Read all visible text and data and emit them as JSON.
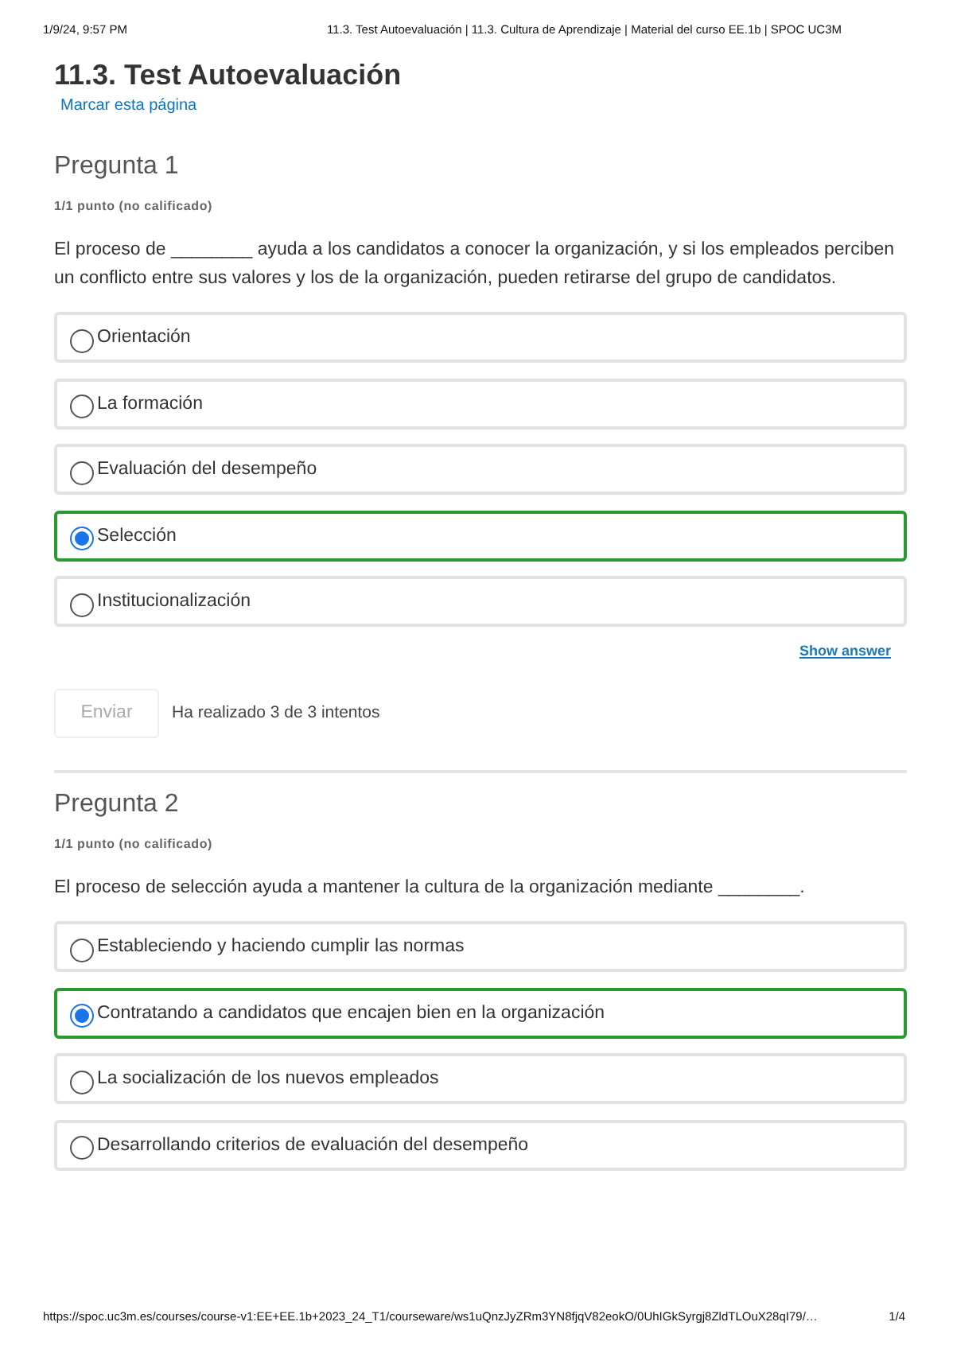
{
  "print_header": {
    "date": "1/9/24, 9:57 PM",
    "title": "11.3. Test Autoevaluación | 11.3. Cultura de Aprendizaje | Material del curso EE.1b | SPOC UC3M"
  },
  "page": {
    "title": "11.3. Test Autoevaluación",
    "bookmark_link": "Marcar esta página"
  },
  "problems": [
    {
      "heading": "Pregunta 1",
      "points": "1/1 punto (no calificado)",
      "question": "El proceso de ________ ayuda a los candidatos a conocer la organización, y si los empleados perciben un conflicto entre sus valores y los de la organización, pueden retirarse del grupo de candidatos.",
      "choices": [
        {
          "label": "Orientación",
          "selected": false,
          "correct": false
        },
        {
          "label": "La formación",
          "selected": false,
          "correct": false
        },
        {
          "label": "Evaluación del desempeño",
          "selected": false,
          "correct": false
        },
        {
          "label": "Selección",
          "selected": true,
          "correct": true
        },
        {
          "label": "Institucionalización",
          "selected": false,
          "correct": false
        }
      ],
      "show_answer": "Show answer",
      "submit": {
        "label": "Enviar",
        "disabled": true
      },
      "attempts": "Ha realizado 3 de 3 intentos"
    },
    {
      "heading": "Pregunta 2",
      "points": "1/1 punto (no calificado)",
      "question": "El proceso de selección ayuda a mantener la cultura de la organización mediante ________.",
      "choices": [
        {
          "label": "Estableciendo y haciendo cumplir las normas",
          "selected": false,
          "correct": false
        },
        {
          "label": "Contratando a candidatos que encajen bien en la organización",
          "selected": true,
          "correct": true
        },
        {
          "label": "La socialización de los nuevos empleados",
          "selected": false,
          "correct": false
        },
        {
          "label": "Desarrollando criterios de evaluación del desempeño",
          "selected": false,
          "correct": false
        }
      ]
    }
  ],
  "print_footer": {
    "url": "https://spoc.uc3m.es/courses/course-v1:EE+EE.1b+2023_24_T1/courseware/ws1uQnzJyZRm3YN8fjqV82eokO/0UhIGkSyrgj8ZldTLOuX28qI79/…",
    "page": "1/4"
  }
}
